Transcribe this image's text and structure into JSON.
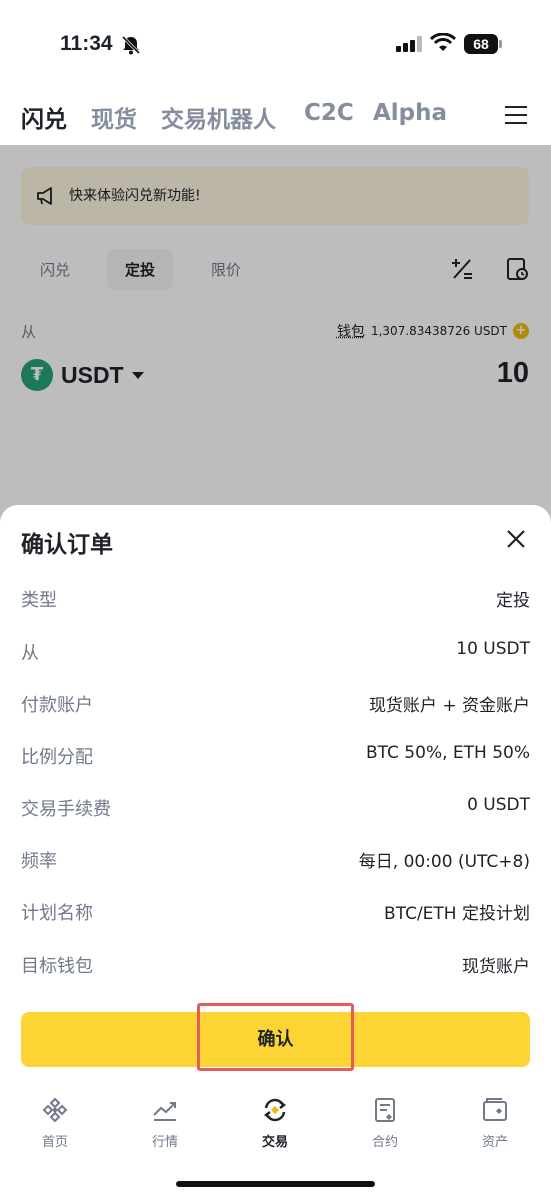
{
  "status_bar": {
    "time": "11:34",
    "battery": "68"
  },
  "top_tabs": [
    {
      "label": "闪兑",
      "active": true
    },
    {
      "label": "现货",
      "active": false
    },
    {
      "label": "交易机器人",
      "active": false
    },
    {
      "label": "C2C",
      "active": false
    },
    {
      "label": "Alpha",
      "active": false
    }
  ],
  "promo": {
    "text": "快来体验闪兑新功能!"
  },
  "sub_tabs": [
    {
      "label": "闪兑",
      "active": false
    },
    {
      "label": "定投",
      "active": true
    },
    {
      "label": "限价",
      "active": false
    }
  ],
  "from": {
    "label": "从",
    "wallet_label": "钱包",
    "wallet_balance": "1,307.83438726 USDT",
    "coin": "USDT",
    "amount": "10"
  },
  "sheet": {
    "title": "确认订单",
    "rows": [
      {
        "label": "类型",
        "value": "定投"
      },
      {
        "label": "从",
        "value": "10 USDT"
      },
      {
        "label": "付款账户",
        "value": "现货账户 + 资金账户"
      },
      {
        "label": "比例分配",
        "value": "BTC 50%, ETH 50%"
      },
      {
        "label": "交易手续费",
        "value": "0 USDT"
      },
      {
        "label": "频率",
        "value": "每日, 00:00 (UTC+8)"
      },
      {
        "label": "计划名称",
        "value": "BTC/ETH 定投计划"
      },
      {
        "label": "目标钱包",
        "value": "现货账户"
      }
    ],
    "confirm_label": "确认"
  },
  "bottom_nav": [
    {
      "label": "首页",
      "icon": "home-icon",
      "active": false
    },
    {
      "label": "行情",
      "icon": "markets-icon",
      "active": false
    },
    {
      "label": "交易",
      "icon": "trade-icon",
      "active": true
    },
    {
      "label": "合约",
      "icon": "futures-icon",
      "active": false
    },
    {
      "label": "资产",
      "icon": "assets-icon",
      "active": false
    }
  ],
  "colors": {
    "brand_yellow": "#FCD535",
    "accent": "#F0B90B",
    "highlight": "#E85B5B",
    "usdt_green": "#26A17B"
  }
}
